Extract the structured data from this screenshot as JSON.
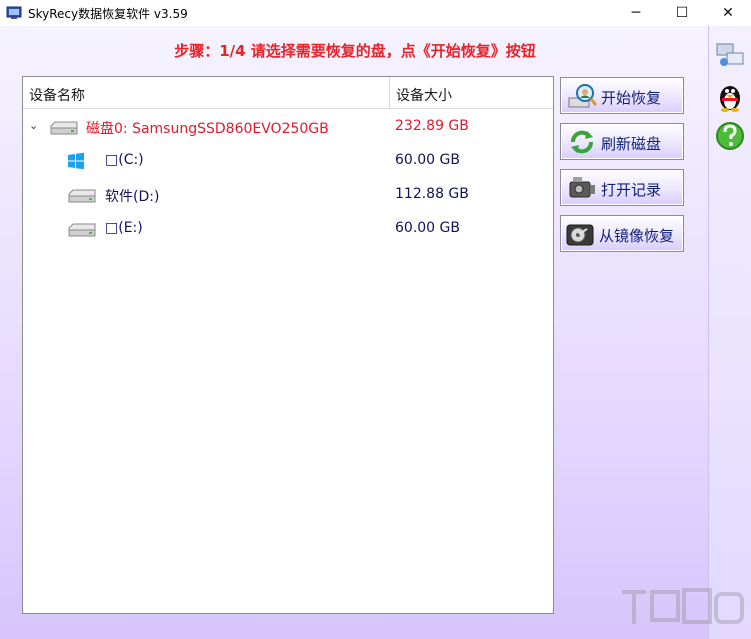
{
  "window": {
    "title": "SkyRecy数据恢复软件 v3.59",
    "minimize_glyph": "─",
    "maximize_glyph": "☐",
    "close_glyph": "✕"
  },
  "step": {
    "text": "步骤：1/4 请选择需要恢复的盘，点《开始恢复》按钮",
    "color": "#e8242a"
  },
  "device_list": {
    "columns": {
      "name": "设备名称",
      "size": "设备大小"
    },
    "disk": {
      "expander": "⌄",
      "icon": "hard-drive-icon",
      "name": "磁盘0: SamsungSSD860EVO250GB",
      "size": "232.89 GB"
    },
    "volumes": [
      {
        "icon": "windows-logo-icon",
        "name": "□(C:)",
        "size": "60.00 GB"
      },
      {
        "icon": "drive-icon",
        "name": "软件(D:)",
        "size": "112.88 GB"
      },
      {
        "icon": "drive-icon",
        "name": "□(E:)",
        "size": "60.00 GB"
      }
    ]
  },
  "actions": {
    "start_recovery": {
      "label": "开始恢复",
      "icon": "magnifier-person-icon"
    },
    "refresh_disks": {
      "label": "刷新磁盘",
      "icon": "refresh-icon"
    },
    "open_records": {
      "label": "打开记录",
      "icon": "recorder-icon"
    },
    "image_recovery": {
      "label": "从镜像恢复",
      "icon": "disk-image-icon"
    }
  },
  "side": {
    "icons": [
      "network-icon",
      "qq-penguin-icon",
      "help-icon"
    ]
  },
  "colors": {
    "accent_red": "#e01a2b",
    "volume_text": "#12125a",
    "button_text": "#0e1f78"
  }
}
